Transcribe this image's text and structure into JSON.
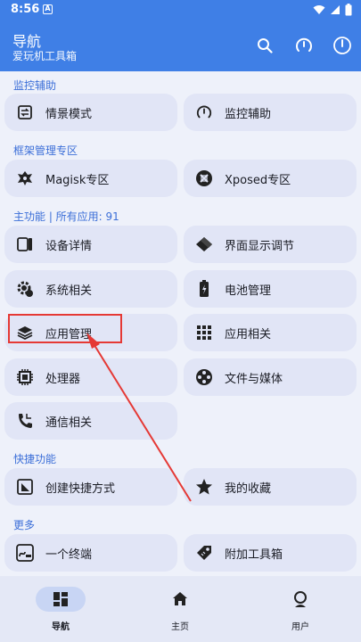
{
  "status": {
    "time": "8:56",
    "notif_icon_letter": "A"
  },
  "appbar": {
    "title": "导航",
    "subtitle": "爱玩机工具箱"
  },
  "sections": {
    "monitor": "监控辅助",
    "framework": "框架管理专区",
    "main_prefix": "主功能 | 所有应用: ",
    "app_count": "91",
    "shortcuts": "快捷功能",
    "more": "更多"
  },
  "cards": {
    "scene_mode": "情景模式",
    "monitor_assist": "监控辅助",
    "magisk": "Magisk专区",
    "xposed": "Xposed专区",
    "device_details": "设备详情",
    "display_adjust": "界面显示调节",
    "system_related": "系统相关",
    "battery": "电池管理",
    "app_management": "应用管理",
    "app_related": "应用相关",
    "processor": "处理器",
    "files_media": "文件与媒体",
    "telecom": "通信相关",
    "create_shortcut": "创建快捷方式",
    "favorites": "我的收藏",
    "terminal": "一个终端",
    "extra_tools": "附加工具箱"
  },
  "nav": {
    "navigation": "导航",
    "home": "主页",
    "user": "用户"
  },
  "colors": {
    "primary": "#3f7fe6",
    "card": "#e1e5f6",
    "accent_text": "#3c6fd8",
    "annotation": "#e53935"
  }
}
